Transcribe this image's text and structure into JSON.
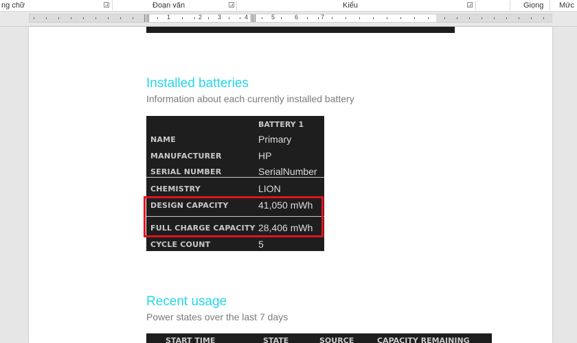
{
  "ribbon": {
    "groups": [
      {
        "label": "ng chữ"
      },
      {
        "label": "Đoạn văn"
      },
      {
        "label": "Kiểu"
      },
      {
        "label": "Giọng"
      },
      {
        "label": "Mức"
      }
    ]
  },
  "ruler": {
    "numbers": [
      "1",
      "1",
      "2",
      "3",
      "4",
      "5",
      "6",
      "7"
    ]
  },
  "installed": {
    "title": "Installed batteries",
    "subtitle": "Information about each currently installed battery",
    "column_header": "BATTERY 1",
    "rows": [
      {
        "label": "NAME",
        "value": "Primary"
      },
      {
        "label": "MANUFACTURER",
        "value": "HP"
      },
      {
        "label": "SERIAL NUMBER",
        "value": "SerialNumber"
      },
      {
        "label": "CHEMISTRY",
        "value": "LION"
      },
      {
        "label": "DESIGN CAPACITY",
        "value": "41,050 mWh"
      },
      {
        "label": "FULL CHARGE CAPACITY",
        "value": "28,406 mWh"
      },
      {
        "label": "CYCLE COUNT",
        "value": "5"
      }
    ]
  },
  "recent": {
    "title": "Recent usage",
    "subtitle": "Power states over the last 7 days",
    "columns": [
      "START TIME",
      "STATE",
      "SOURCE",
      "CAPACITY REMAINING"
    ]
  },
  "colors": {
    "heading": "#23d7e6",
    "highlight_box": "#e0141e",
    "table_bg": "#1e1e1e"
  }
}
